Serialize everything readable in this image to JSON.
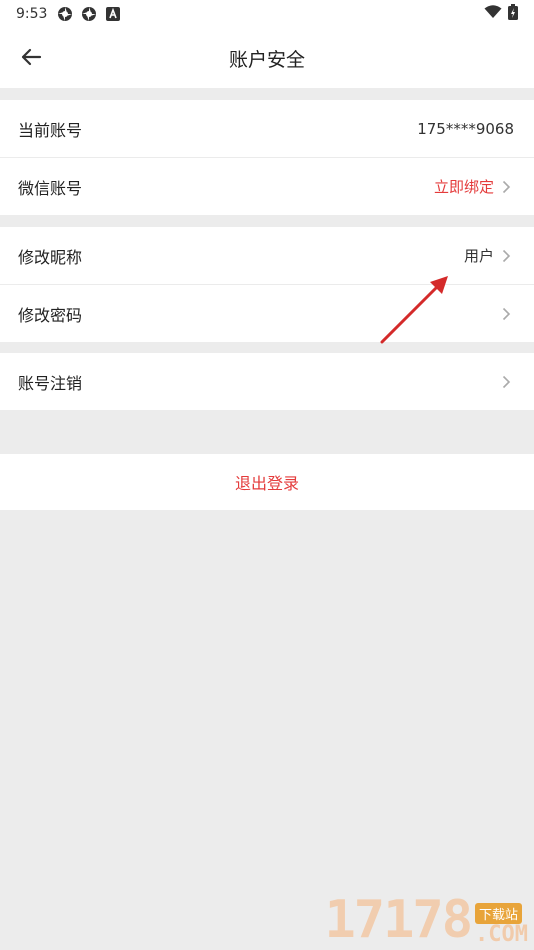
{
  "status_bar": {
    "time": "9:53",
    "icons": [
      "settings-gear-icon",
      "settings-gear-icon",
      "app-a-icon",
      "wifi-icon",
      "battery-charging-icon"
    ]
  },
  "header": {
    "title": "账户安全",
    "back_icon": "arrow-left-icon"
  },
  "rows": {
    "current_account": {
      "label": "当前账号",
      "value": "175****9068"
    },
    "wechat_account": {
      "label": "微信账号",
      "value": "立即绑定"
    },
    "nickname": {
      "label": "修改昵称",
      "value": "用户"
    },
    "password": {
      "label": "修改密码"
    },
    "cancel_account": {
      "label": "账号注销"
    }
  },
  "logout": {
    "label": "退出登录"
  },
  "colors": {
    "accent_red": "#e43b3b",
    "background": "#ececec",
    "card": "#ffffff"
  },
  "watermark": {
    "number": "17178",
    "tag": "下载站",
    "suffix": ".COM"
  }
}
